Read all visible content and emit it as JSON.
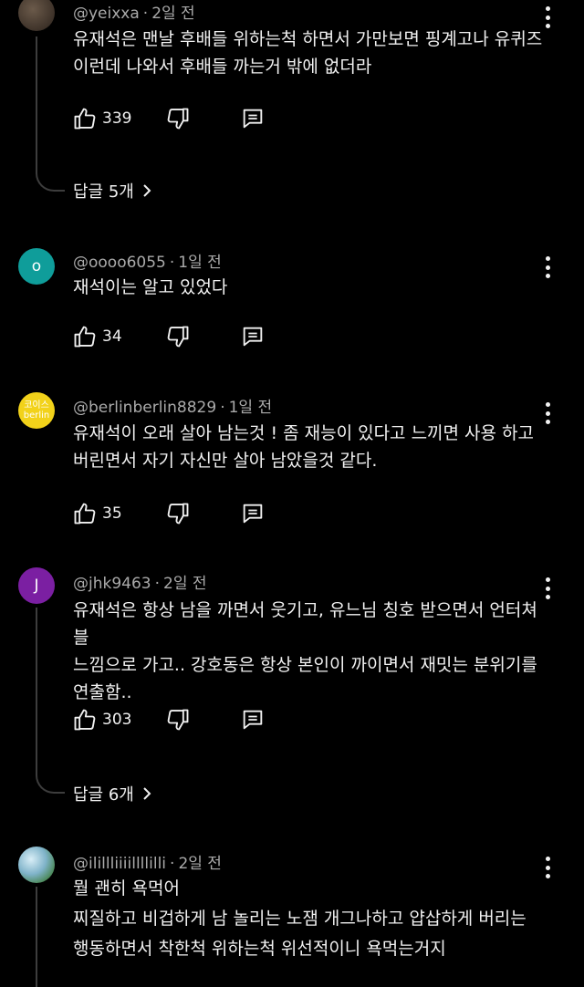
{
  "comments": [
    {
      "author": "@yeixxa",
      "time": "2일 전",
      "text": "유재석은 맨날 후배들 위하는척 하면서 가만보면 핑계고나 유퀴즈\n이런데 나와서 후배들 까는거 밖에 없더라",
      "likes": "339",
      "replies": "답글 5개"
    },
    {
      "author": "@oooo6055",
      "time": "1일 전",
      "avatar_letter": "o",
      "avatar_color": "#0f9d9a",
      "text": "재석이는 알고 있었다",
      "likes": "34"
    },
    {
      "author": "@berlinberlin8829",
      "time": "1일 전",
      "avatar_line1": "코이스",
      "avatar_line2": "berlin",
      "avatar_color": "#f2d21a",
      "text": "유재석이 오래 살아 남는것 ! 좀 재능이 있다고 느끼면 사용 하고\n버린면서 자기 자신만 살아 남았을것 같다.",
      "likes": "35"
    },
    {
      "author": "@jhk9463",
      "time": "2일 전",
      "avatar_letter": "J",
      "avatar_color": "#7b1fa2",
      "text": "유재석은 항상 남을 까면서 웃기고, 유느님 칭호 받으면서 언터쳐블\n느낌으로 가고.. 강호동은 항상 본인이 까이면서 재밋는 분위기를\n연출함..",
      "likes": "303",
      "replies": "답글 6개"
    },
    {
      "author": "@ilillliiiillllilli",
      "time": "2일 전",
      "text": "뭘 괜히 욕먹어\n찌질하고 비겁하게 남 놀리는 노잼 개그나하고 얍삽하게 버리는\n행동하면서 착한척 위하는척 위선적이니 욕먹는거지"
    }
  ],
  "separator": "·",
  "colors": {
    "background": "#000000",
    "text": "#f1f1f1",
    "meta": "#aaaaaa",
    "thread_line": "#3d3d3d"
  }
}
